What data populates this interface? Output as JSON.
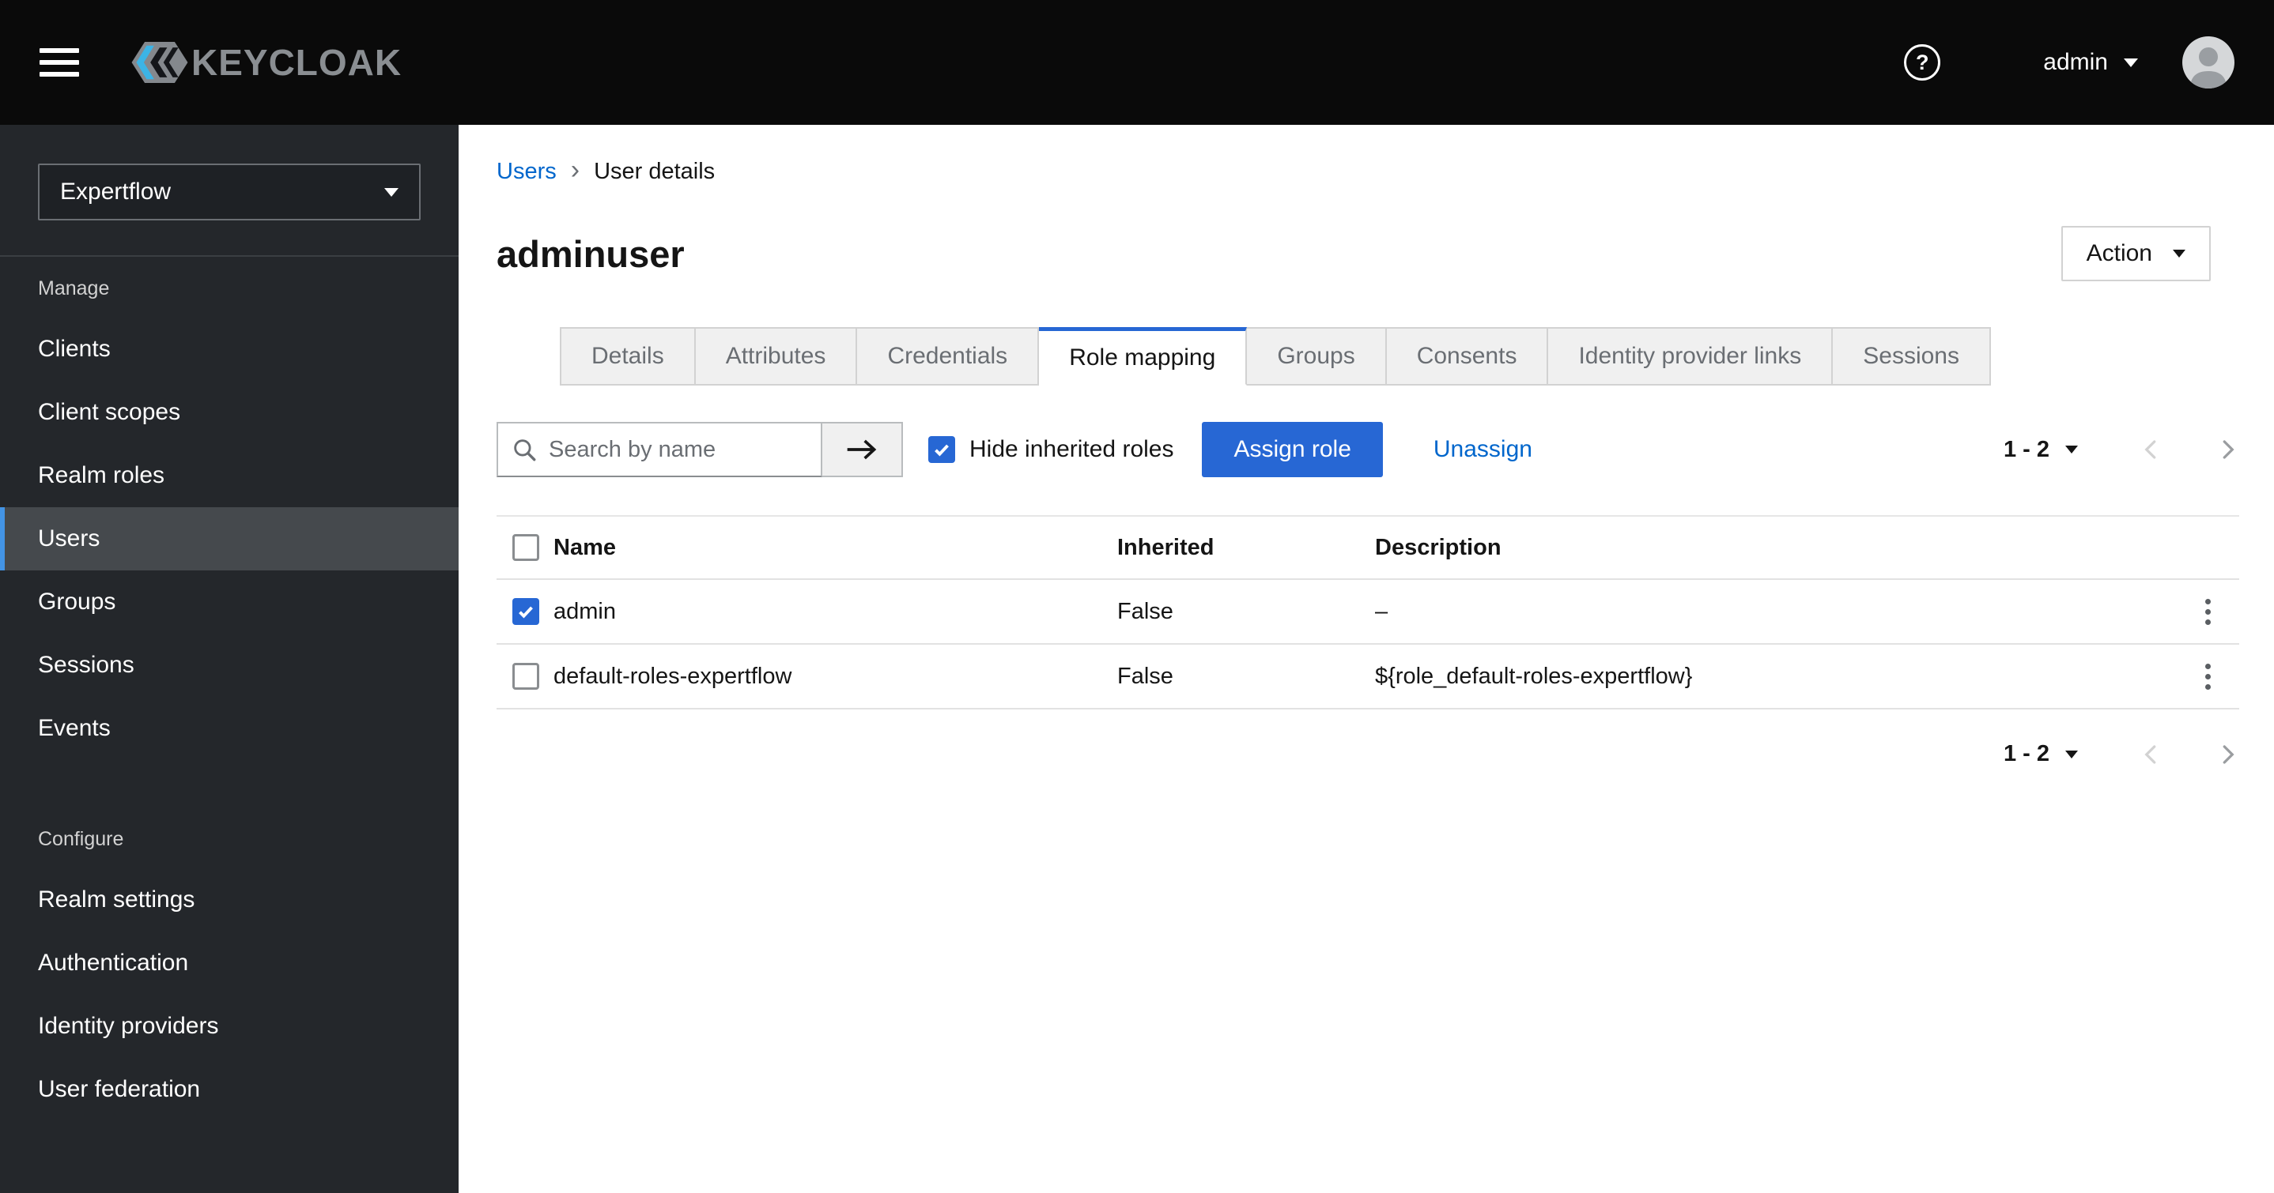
{
  "colors": {
    "masthead_bg": "#0a0a0a",
    "sidebar_bg": "#24272b",
    "primary_blue": "#2767d4",
    "link_blue": "#0066cc",
    "active_nav_bg": "#45494d"
  },
  "masthead": {
    "brand": "KEYCLOAK",
    "user": "admin"
  },
  "sidebar": {
    "realm": "Expertflow",
    "sections": [
      {
        "label": "Manage",
        "items": [
          {
            "label": "Clients",
            "active": false
          },
          {
            "label": "Client scopes",
            "active": false
          },
          {
            "label": "Realm roles",
            "active": false
          },
          {
            "label": "Users",
            "active": true
          },
          {
            "label": "Groups",
            "active": false
          },
          {
            "label": "Sessions",
            "active": false
          },
          {
            "label": "Events",
            "active": false
          }
        ]
      },
      {
        "label": "Configure",
        "items": [
          {
            "label": "Realm settings",
            "active": false
          },
          {
            "label": "Authentication",
            "active": false
          },
          {
            "label": "Identity providers",
            "active": false
          },
          {
            "label": "User federation",
            "active": false
          }
        ]
      }
    ]
  },
  "main": {
    "breadcrumb": {
      "items": [
        {
          "label": "Users"
        },
        {
          "label": "User details"
        }
      ]
    },
    "title": "adminuser",
    "action_button": "Action",
    "tabs": [
      {
        "label": "Details",
        "active": false
      },
      {
        "label": "Attributes",
        "active": false
      },
      {
        "label": "Credentials",
        "active": false
      },
      {
        "label": "Role mapping",
        "active": true
      },
      {
        "label": "Groups",
        "active": false
      },
      {
        "label": "Consents",
        "active": false
      },
      {
        "label": "Identity provider links",
        "active": false
      },
      {
        "label": "Sessions",
        "active": false
      }
    ],
    "toolbar": {
      "search_placeholder": "Search by name",
      "hide_inherited_label": "Hide inherited roles",
      "hide_inherited_checked": true,
      "assign_button": "Assign role",
      "unassign_link": "Unassign",
      "pagination": "1 - 2"
    },
    "table": {
      "columns": [
        "Name",
        "Inherited",
        "Description"
      ],
      "rows": [
        {
          "checked": true,
          "name": "admin",
          "inherited": "False",
          "description": "–"
        },
        {
          "checked": false,
          "name": "default-roles-expertflow",
          "inherited": "False",
          "description": "${role_default-roles-expertflow}"
        }
      ]
    },
    "bottom_pagination": "1 - 2"
  }
}
